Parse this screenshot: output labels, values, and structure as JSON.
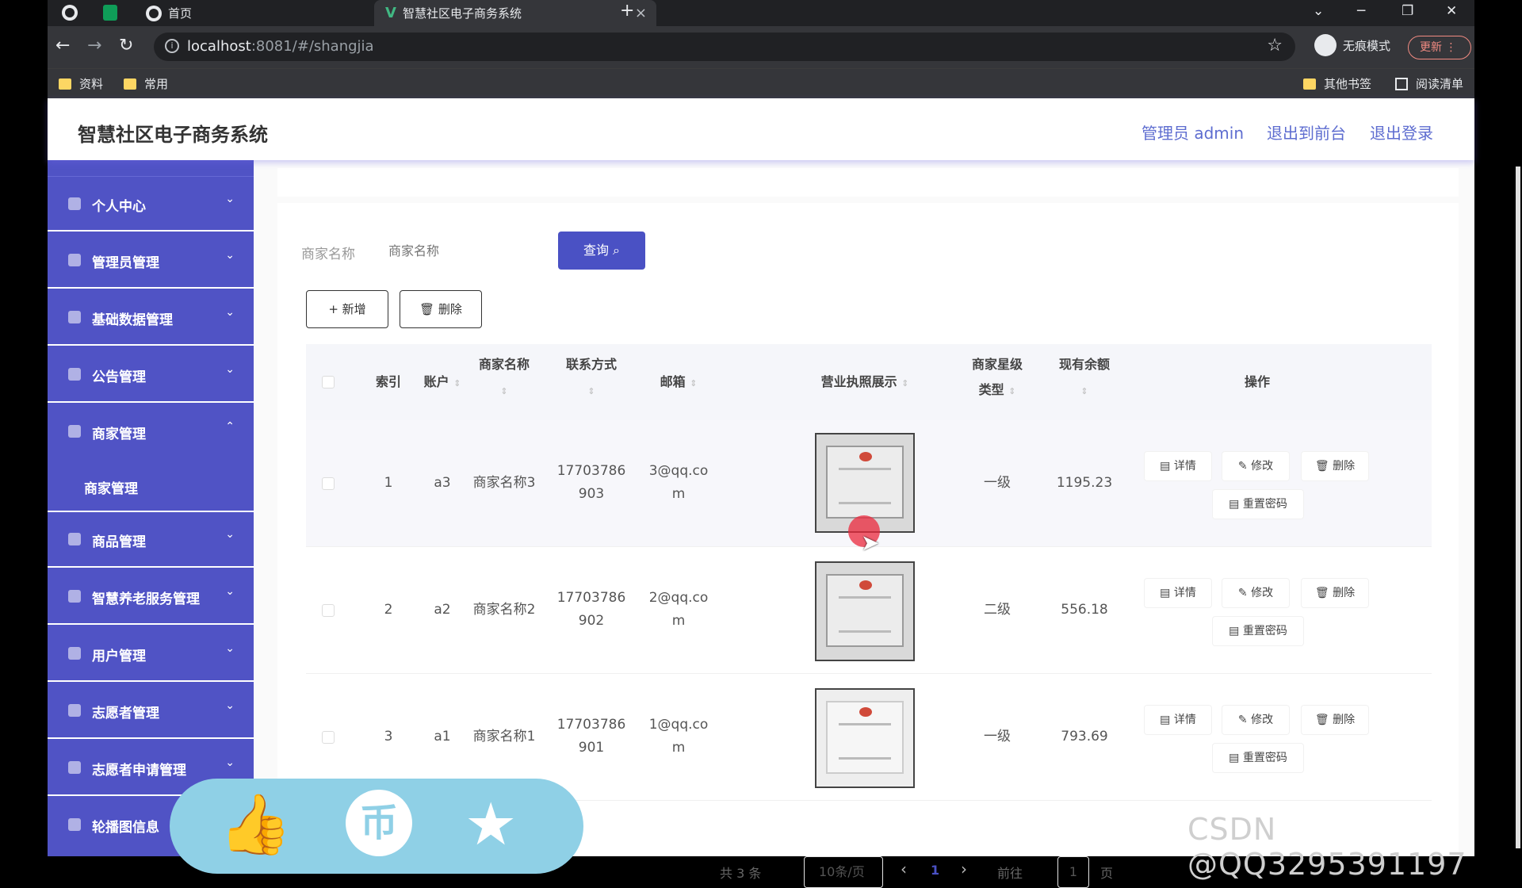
{
  "browser": {
    "tabs": [
      {
        "title": "首页",
        "close": "×"
      },
      {
        "title": "智慧社区电子商务系统",
        "close": "×"
      }
    ],
    "new_tab": "+",
    "window_controls": {
      "dropdown": "⌄",
      "minimize": "─",
      "restore": "❐",
      "close": "✕"
    },
    "nav": {
      "back": "←",
      "forward": "→",
      "reload": "↻"
    },
    "url": {
      "host": "localhost",
      "rest": ":8081/#/shangjia"
    },
    "incognito_label": "无痕模式",
    "update_label": "更新 ⋮",
    "bookmarks": [
      "资料",
      "常用"
    ],
    "other_bookmarks": "其他书签",
    "reading_list": "阅读清单"
  },
  "header": {
    "title": "智慧社区电子商务系统",
    "admin_label": "管理员 admin",
    "to_front": "退出到前台",
    "logout": "退出登录"
  },
  "sidebar": {
    "items": [
      {
        "label": "个人中心",
        "arrow": "⌄"
      },
      {
        "label": "管理员管理",
        "arrow": "⌄"
      },
      {
        "label": "基础数据管理",
        "arrow": "⌄"
      },
      {
        "label": "公告管理",
        "arrow": "⌄"
      },
      {
        "label": "商家管理",
        "arrow": "⌃"
      },
      {
        "label": "商品管理",
        "arrow": "⌄"
      },
      {
        "label": "智慧养老服务管理",
        "arrow": "⌄"
      },
      {
        "label": "用户管理",
        "arrow": "⌄"
      },
      {
        "label": "志愿者管理",
        "arrow": "⌄"
      },
      {
        "label": "志愿者申请管理",
        "arrow": "⌄"
      },
      {
        "label": "轮播图信息",
        "arrow": ""
      }
    ],
    "submenu": "商家管理"
  },
  "search": {
    "label": "商家名称",
    "placeholder": "商家名称",
    "query_button": "查询 ⌕"
  },
  "toolbar": {
    "add_button": "+ 新增",
    "delete_button": "🗑 删除"
  },
  "table": {
    "columns": {
      "index": "索引",
      "account": "账户",
      "name": "商家名称",
      "phone": "联系方式",
      "email": "邮箱",
      "license": "营业执照展示",
      "level_line1": "商家星级",
      "level_line2": "类型",
      "balance": "现有余额",
      "actions": "操作"
    },
    "sort_icon": "⇕",
    "actions": {
      "detail": "▤ 详情",
      "edit": "✎ 修改",
      "delete": "🗑 删除",
      "reset": "▤ 重置密码"
    },
    "rows": [
      {
        "index": "1",
        "account": "a3",
        "name": "商家名称3",
        "phone_1": "17703786",
        "phone_2": "903",
        "email_1": "3@qq.co",
        "email_2": "m",
        "level": "一级",
        "balance": "1195.23"
      },
      {
        "index": "2",
        "account": "a2",
        "name": "商家名称2",
        "phone_1": "17703786",
        "phone_2": "902",
        "email_1": "2@qq.co",
        "email_2": "m",
        "level": "二级",
        "balance": "556.18"
      },
      {
        "index": "3",
        "account": "a1",
        "name": "商家名称1",
        "phone_1": "17703786",
        "phone_2": "901",
        "email_1": "1@qq.co",
        "email_2": "m",
        "level": "一级",
        "balance": "793.69"
      }
    ]
  },
  "pagination": {
    "total": "共 3 条",
    "page_size": "10条/页",
    "prev": "‹",
    "current": "1",
    "next": "›",
    "goto_label": "前往",
    "goto_value": "1",
    "page_suffix": "页"
  },
  "overlay": {
    "like": "👍",
    "coin": "币",
    "favorite": "★"
  },
  "watermark": "CSDN @QQ3295391197"
}
